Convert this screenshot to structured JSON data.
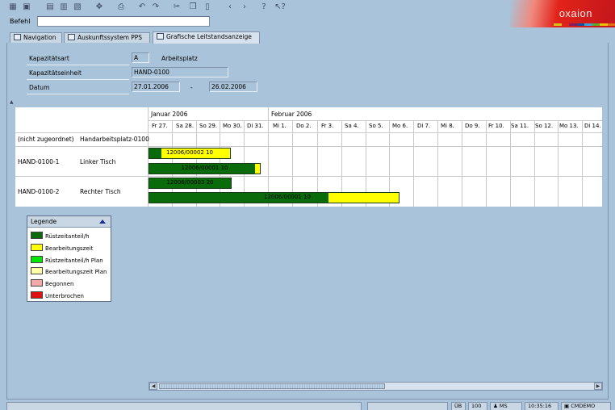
{
  "toolbar": {
    "icons": [
      "grid-icon",
      "save-icon",
      "copy-doc-icon",
      "disk-icon",
      "settings-icon",
      "print-icon",
      "undo-icon",
      "redo-icon",
      "cut-icon",
      "copy-icon",
      "paste-icon",
      "back-icon",
      "forward-icon",
      "help-icon",
      "context-help-icon"
    ]
  },
  "logo": {
    "text": "oxaion"
  },
  "command": {
    "label": "Befehl",
    "value": ""
  },
  "tabs": [
    {
      "label": "Navigation"
    },
    {
      "label": "Auskunftssystem PPS"
    },
    {
      "label": "Grafische Leitstandsanzeige"
    }
  ],
  "header": {
    "kapazitaetsart_label": "Kapazitätsart",
    "kapazitaetsart_value": "A",
    "kapazitaetsart_desc": "Arbeitsplatz",
    "kapazitaetseinheit_label": "Kapazitätseinheit",
    "kapazitaetseinheit_value": "HAND-0100",
    "datum_label": "Datum",
    "datum_from": "27.01.2006",
    "datum_sep": "-",
    "datum_to": "26.02.2006"
  },
  "gantt": {
    "months": [
      "Januar 2006",
      "Februar 2006"
    ],
    "days": [
      "Fr 27.",
      "Sa 28.",
      "So 29.",
      "Mo 30.",
      "Di 31.",
      "Mi 1.",
      "Do 2.",
      "Fr 3.",
      "Sa 4.",
      "So 5.",
      "Mo 6.",
      "Di 7.",
      "Mi 8.",
      "Do 9.",
      "Fr 10.",
      "Sa 11.",
      "So 12.",
      "Mo 13.",
      "Di 14."
    ],
    "rows": [
      {
        "id": "(nicht zugeordnet)",
        "name": "Handarbeitsplatz-0100"
      },
      {
        "id": "HAND-0100-1",
        "name": "Linker Tisch"
      },
      {
        "id": "HAND-0100-2",
        "name": "Rechter Tisch"
      }
    ],
    "bars": [
      {
        "label": "12006/00002 10"
      },
      {
        "label": "12006/00001 10"
      },
      {
        "label": "12006/00003 20"
      },
      {
        "label": "12006/00001 10"
      }
    ]
  },
  "legend": {
    "title": "Legende",
    "items": [
      {
        "label": "Rüstzeitanteil/h",
        "color": "#0a6b0a"
      },
      {
        "label": "Bearbeitungszeit",
        "color": "#ffff00"
      },
      {
        "label": "Rüstzeitanteil/h Plan",
        "color": "#00e600"
      },
      {
        "label": "Bearbeitungszeit Plan",
        "color": "#ffffa8"
      },
      {
        "label": "Begonnen",
        "color": "#f4a8a8"
      },
      {
        "label": "Unterbrochen",
        "color": "#e01010"
      }
    ]
  },
  "statusbar": {
    "ub": "ÜB",
    "count": "100",
    "user": "MS",
    "time": "10:35:16",
    "env": "CMDEMO"
  },
  "colors": {
    "accent_green": "#0a6b0a",
    "accent_yellow": "#ffff00",
    "background": "#a9c3da"
  }
}
